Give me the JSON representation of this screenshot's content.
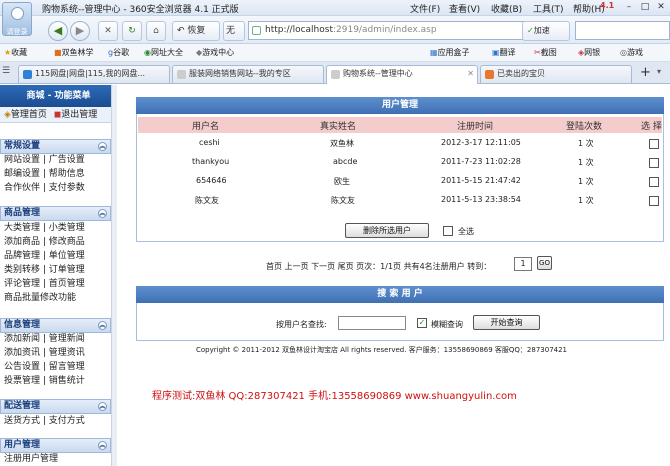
{
  "window": {
    "title": "购物系统--管理中心 - 360安全浏览器 4.1 正式版",
    "avatar_label": "请登录",
    "menus": [
      "文件(F)",
      "查看(V)",
      "收藏(B)",
      "工具(T)",
      "帮助(H)"
    ],
    "version_badge": "4.1"
  },
  "nav": {
    "undo": "恢复",
    "cloud": "无痕",
    "url_host": "http://localhost",
    "url_rest": ":2919/admin/index.asp",
    "accelerate": "加速"
  },
  "bookmarks": {
    "left": [
      "收藏",
      "双鱼林学",
      "谷歌",
      "网址大全",
      "游戏中心"
    ],
    "right": [
      "应用盒子",
      "翻译",
      "截图",
      "网银",
      "游戏"
    ]
  },
  "tabs": [
    {
      "label": "115网盘|网盘|115,我的网盘..."
    },
    {
      "label": "服装网络销售网站--我的专区"
    },
    {
      "label": "购物系统--管理中心"
    },
    {
      "label": "已卖出的宝贝"
    }
  ],
  "sidebar": {
    "header": "商城 - 功能菜单",
    "home": "管理首页",
    "logout": "退出管理",
    "groups": [
      {
        "title": "常规设置",
        "items": [
          "网站设置 | 广告设置",
          "邮编设置 | 帮助信息",
          "合作伙伴 | 支付参数"
        ]
      },
      {
        "title": "商品管理",
        "items": [
          "大类管理 | 小类管理",
          "添加商品 | 修改商品",
          "品牌管理 | 单位管理",
          "类别转移 | 订单管理",
          "评论管理 | 首页管理",
          "商品批量修改功能"
        ]
      },
      {
        "title": "信息管理",
        "items": [
          "添加新闻 | 管理新闻",
          "添加资讯 | 管理资讯",
          "公告设置 | 留言管理",
          "投票管理 | 销售统计"
        ]
      },
      {
        "title": "配送管理",
        "items": [
          "送货方式 | 支付方式"
        ]
      },
      {
        "title": "用户管理",
        "items": [
          "注册用户管理"
        ]
      }
    ]
  },
  "users_panel": {
    "title": "用户管理",
    "columns": [
      "用户名",
      "真实姓名",
      "注册时间",
      "登陆次数",
      "选 择"
    ],
    "rows": [
      {
        "username": "ceshi",
        "realname": "双鱼林",
        "time": "2012-3-17 12:11:05",
        "logins": "1 次"
      },
      {
        "username": "thankyou",
        "realname": "abcde",
        "time": "2011-7-23 11:02:28",
        "logins": "1 次"
      },
      {
        "username": "654646",
        "realname": "欧生",
        "time": "2011-5-15 21:47:42",
        "logins": "1 次"
      },
      {
        "username": "陈文友",
        "realname": "陈文友",
        "time": "2011-5-13 23:38:54",
        "logins": "1 次"
      }
    ],
    "delete_btn": "删除所选用户",
    "select_all": "全选"
  },
  "pager": {
    "text": "首页  上一页  下一页  尾页  页次：1/1页  共有4名注册用户  转到：",
    "page_value": "1",
    "go": "GO"
  },
  "search_panel": {
    "title": "搜 索 用 户",
    "label": "按用户名查找:",
    "fuzzy": "模糊查询",
    "button": "开始查询"
  },
  "footer": {
    "copyright": "Copyright © 2011-2012  双鱼林设计淘宝店 All rights reserved. 客户服务：13558690869  客服QQ：287307421",
    "promo": "程序测试:双鱼林 QQ:287307421 手机:13558690869 www.shuangyulin.com"
  },
  "colors": {
    "header_blue": "#3f70b4",
    "row_pink": "#f5cccc",
    "promo_red": "#d01010"
  }
}
